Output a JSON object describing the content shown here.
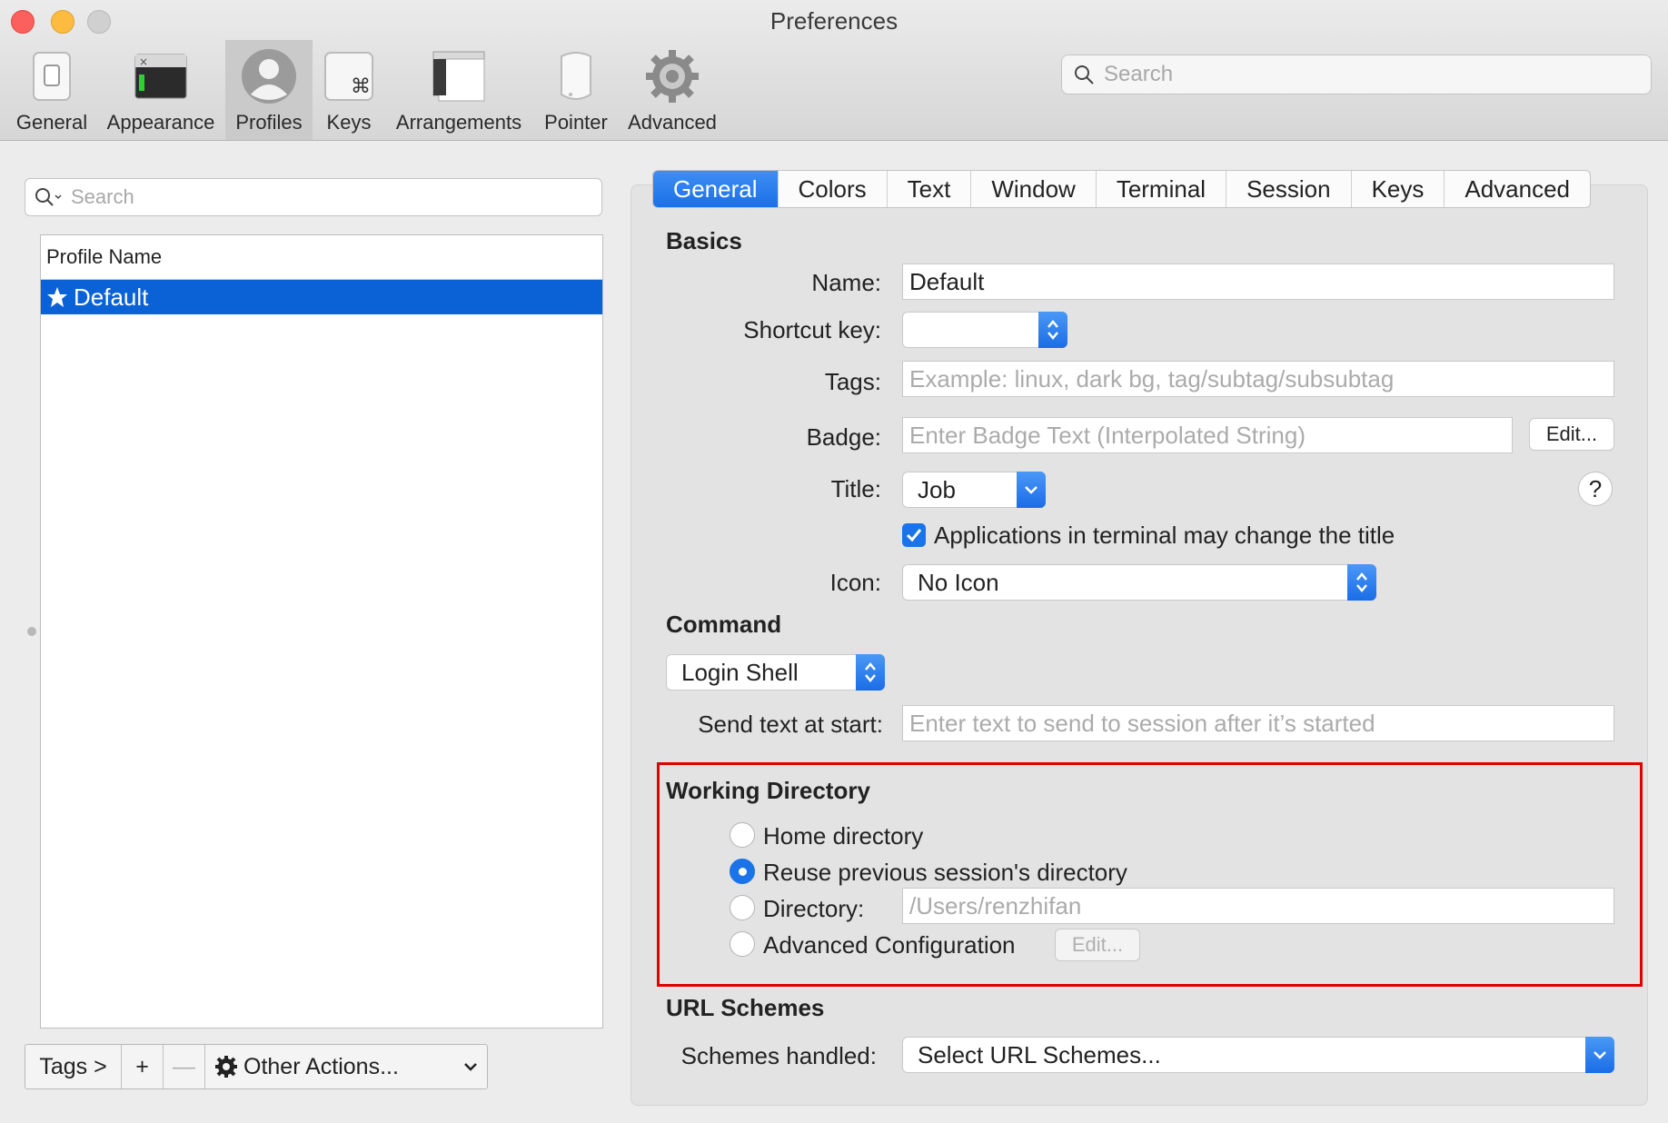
{
  "window": {
    "title": "Preferences",
    "traffic_lights": [
      "#fc605c",
      "#fdbc40",
      "#d0d0d0"
    ]
  },
  "toolbar": {
    "items": [
      {
        "label": "General",
        "icon": "switch-icon"
      },
      {
        "label": "Appearance",
        "icon": "terminal-window-icon"
      },
      {
        "label": "Profiles",
        "icon": "person-icon"
      },
      {
        "label": "Keys",
        "icon": "command-key-icon"
      },
      {
        "label": "Arrangements",
        "icon": "windows-icon"
      },
      {
        "label": "Pointer",
        "icon": "mouse-icon"
      },
      {
        "label": "Advanced",
        "icon": "gear-icon"
      }
    ],
    "selected": "Profiles",
    "search_placeholder": "Search"
  },
  "profiles": {
    "search_placeholder": "Search",
    "column_header": "Profile Name",
    "rows": [
      {
        "name": "Default",
        "icon": "star-icon",
        "selected": true
      }
    ],
    "bottom_bar": {
      "tags": "Tags >",
      "add": "+",
      "remove": "—",
      "other_actions": "Other Actions..."
    }
  },
  "tabs": [
    "General",
    "Colors",
    "Text",
    "Window",
    "Terminal",
    "Session",
    "Keys",
    "Advanced"
  ],
  "active_tab": "General",
  "basics": {
    "heading": "Basics",
    "name_label": "Name:",
    "name_value": "Default",
    "shortcut_label": "Shortcut key:",
    "shortcut_value": "",
    "tags_label": "Tags:",
    "tags_placeholder": "Example: linux, dark bg, tag/subtag/subsubtag",
    "badge_label": "Badge:",
    "badge_placeholder": "Enter Badge Text (Interpolated String)",
    "badge_edit": "Edit...",
    "title_label": "Title:",
    "title_value": "Job",
    "help": "?",
    "change_title_checkbox": "Applications in terminal may change the title",
    "change_title_checked": true,
    "icon_label": "Icon:",
    "icon_value": "No Icon"
  },
  "command": {
    "heading": "Command",
    "value": "Login Shell",
    "send_text_label": "Send text at start:",
    "send_text_placeholder": "Enter text to send to session after it’s started"
  },
  "working_directory": {
    "heading": "Working Directory",
    "options": {
      "home": "Home directory",
      "reuse": "Reuse previous session's directory",
      "directory": "Directory:",
      "advanced": "Advanced Configuration"
    },
    "selected": "reuse",
    "directory_placeholder": "/Users/renzhifan",
    "advanced_edit": "Edit..."
  },
  "url_schemes": {
    "heading": "URL Schemes",
    "label": "Schemes handled:",
    "value": "Select URL Schemes..."
  },
  "colors": {
    "accent": "#1a6de6",
    "selection": "#0a62d6",
    "highlight_box": "#e00000"
  }
}
